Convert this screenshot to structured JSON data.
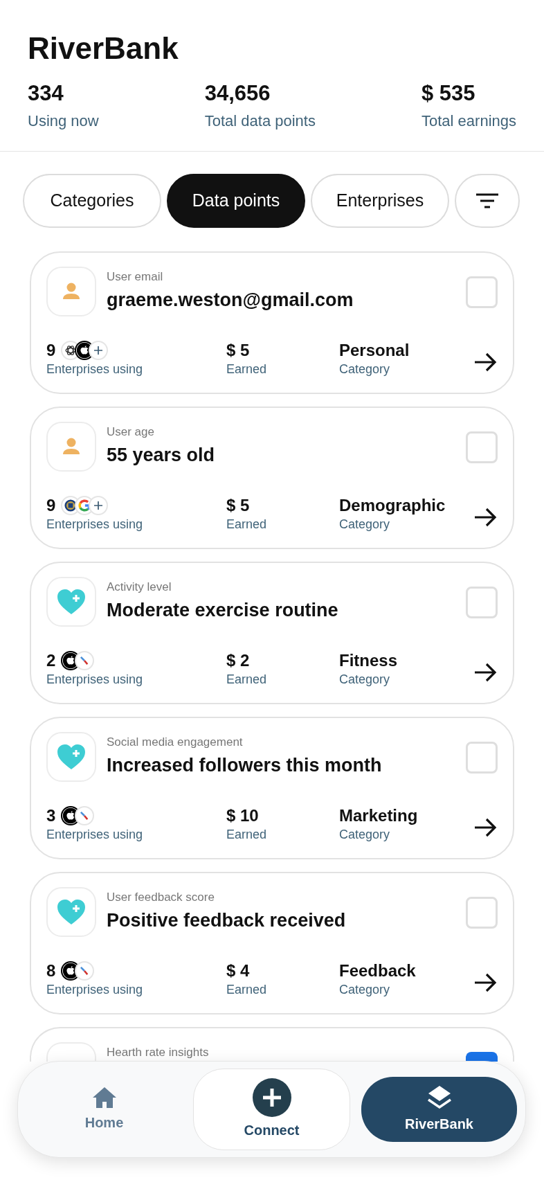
{
  "app": {
    "title": "RiverBank"
  },
  "stats": [
    {
      "value": "334",
      "label": "Using now"
    },
    {
      "value": "34,656",
      "label": "Total data points"
    },
    {
      "value": "$ 535",
      "label": "Total earnings"
    }
  ],
  "tabs": [
    {
      "label": "Categories",
      "selected": false
    },
    {
      "label": "Data points",
      "selected": true
    },
    {
      "label": "Enterprises",
      "selected": false
    }
  ],
  "data_points": [
    {
      "kind": "person",
      "label": "User email",
      "value": "graeme.weston@gmail.com",
      "count": "9",
      "logos": [
        {
          "kind": "knot"
        },
        {
          "kind": "apple"
        },
        {
          "kind": "more"
        }
      ],
      "count_label": "Enterprises using",
      "earned": "$ 5",
      "earned_label": "Earned",
      "category": "Personal",
      "category_label": "Category",
      "checked": false
    },
    {
      "kind": "person",
      "label": "User age",
      "value": "55 years old",
      "count": "9",
      "logos": [
        {
          "kind": "seal"
        },
        {
          "kind": "ring"
        },
        {
          "kind": "more"
        }
      ],
      "count_label": "Enterprises using",
      "earned": "$ 5",
      "earned_label": "Earned",
      "category": "Demographic",
      "category_label": "Category",
      "checked": false
    },
    {
      "kind": "heart",
      "label": "Activity level",
      "value": "Moderate exercise routine",
      "count": "2",
      "logos": [
        {
          "kind": "apple"
        },
        {
          "kind": "stripes"
        }
      ],
      "count_label": "Enterprises using",
      "earned": "$ 2",
      "earned_label": "Earned",
      "category": "Fitness",
      "category_label": "Category",
      "checked": false
    },
    {
      "kind": "heart",
      "label": "Social media engagement",
      "value": "Increased followers this month",
      "count": "3",
      "logos": [
        {
          "kind": "apple"
        },
        {
          "kind": "stripes"
        }
      ],
      "count_label": "Enterprises using",
      "earned": "$ 10",
      "earned_label": "Earned",
      "category": "Marketing",
      "category_label": "Category",
      "checked": false
    },
    {
      "kind": "heart",
      "label": "User feedback score",
      "value": "Positive feedback received",
      "count": "8",
      "logos": [
        {
          "kind": "apple"
        },
        {
          "kind": "stripes"
        }
      ],
      "count_label": "Enterprises using",
      "earned": "$ 4",
      "earned_label": "Earned",
      "category": "Feedback",
      "category_label": "Category",
      "checked": false
    },
    {
      "kind": "partial",
      "label": "Hearth rate insights",
      "checked": true
    }
  ],
  "bottom_nav": [
    {
      "kind": "tab",
      "label": "Home",
      "selected": false
    },
    {
      "kind": "action",
      "label": "Connect",
      "selected": false
    },
    {
      "kind": "tab",
      "label": "RiverBank",
      "selected": true
    }
  ]
}
